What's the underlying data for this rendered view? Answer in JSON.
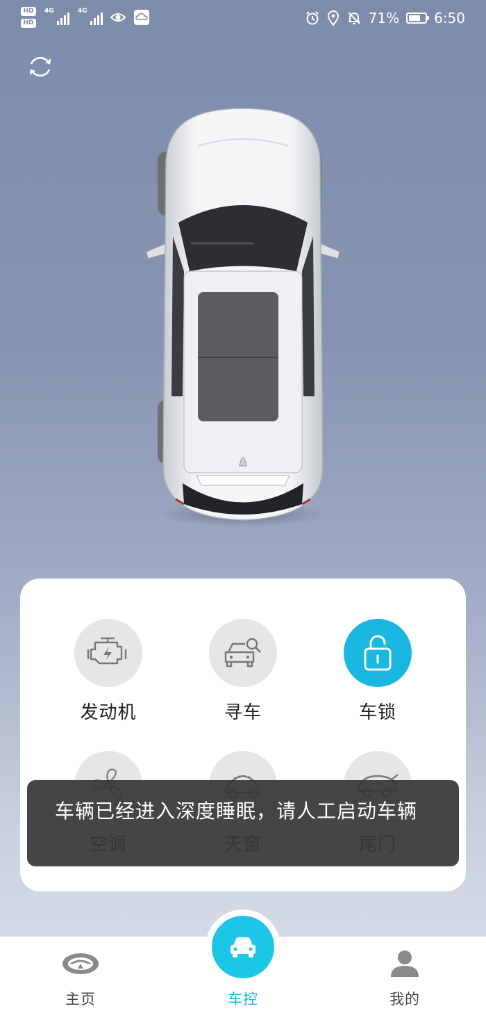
{
  "status_bar": {
    "hd1": "HD",
    "hd2": "HD",
    "net1": "4G",
    "net2": "4G",
    "battery_percent": "71%",
    "battery_level": 0.71,
    "time": "6:50",
    "icons": [
      "eye-icon",
      "cloud-icon",
      "alarm-icon",
      "location-icon",
      "bell-off-icon",
      "battery-icon"
    ]
  },
  "header": {
    "refresh_icon": "refresh-icon"
  },
  "controls": [
    {
      "label": "发动机",
      "icon": "engine-icon",
      "active": false
    },
    {
      "label": "寻车",
      "icon": "find-car-icon",
      "active": false
    },
    {
      "label": "车锁",
      "icon": "unlock-icon",
      "active": true
    },
    {
      "label": "空调",
      "icon": "fan-icon",
      "active": false
    },
    {
      "label": "天窗",
      "icon": "sunroof-icon",
      "active": false
    },
    {
      "label": "尾门",
      "icon": "tailgate-icon",
      "active": false
    }
  ],
  "toast": {
    "message": "车辆已经进入深度睡眠，请人工启动车辆"
  },
  "tabbar": {
    "home": "主页",
    "control": "车控",
    "mine": "我的"
  },
  "colors": {
    "accent": "#1ab8e0",
    "icon_grey": "#7a7a7a",
    "toast_bg": "#373737"
  }
}
